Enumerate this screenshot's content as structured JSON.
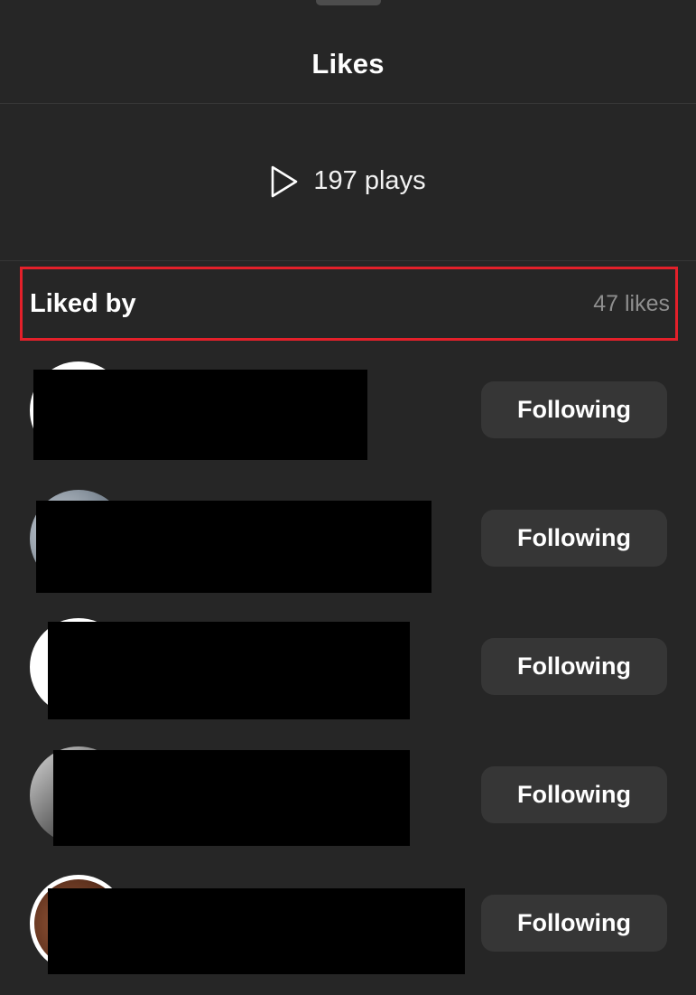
{
  "header": {
    "title": "Likes"
  },
  "plays": {
    "icon": "play-icon",
    "text": "197 plays"
  },
  "liked_by": {
    "title": "Liked by",
    "count": "47 likes"
  },
  "users": [
    {
      "button_label": "Following"
    },
    {
      "button_label": "Following"
    },
    {
      "button_label": "Following"
    },
    {
      "button_label": "Following"
    },
    {
      "button_label": "Following"
    }
  ],
  "colors": {
    "background": "#262626",
    "button": "#363636",
    "highlight_border": "#e3202a",
    "muted_text": "#8e8e8e"
  }
}
